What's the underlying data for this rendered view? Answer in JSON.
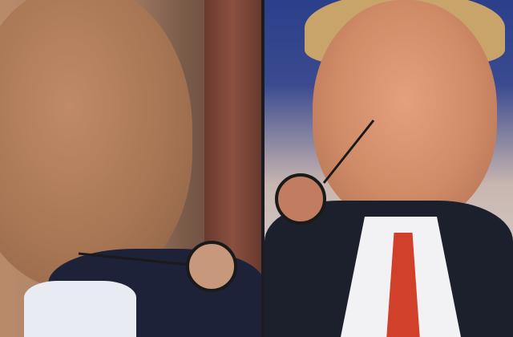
{
  "comparison": {
    "left_swatch": {
      "color": "#c8987c"
    },
    "right_swatch": {
      "color": "#c27c62"
    },
    "pointer_color": "#1a1a1a"
  }
}
